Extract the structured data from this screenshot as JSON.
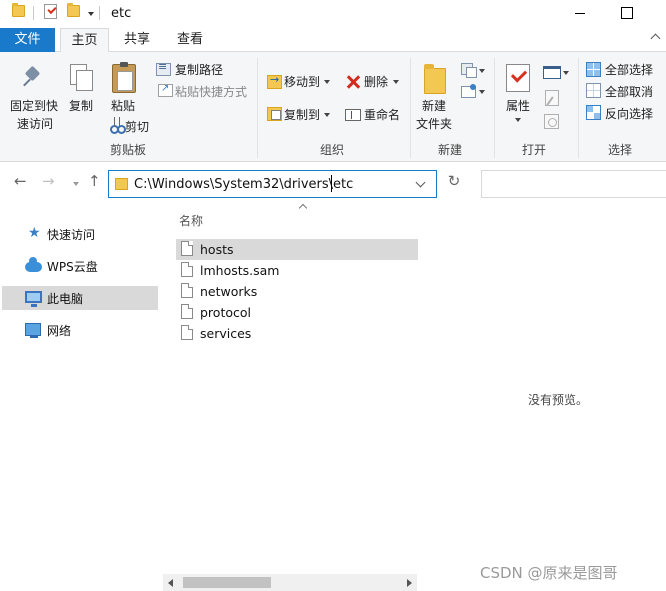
{
  "window": {
    "title": "etc"
  },
  "tabs": [
    {
      "label": "文件"
    },
    {
      "label": "主页"
    },
    {
      "label": "共享"
    },
    {
      "label": "查看"
    }
  ],
  "ribbon": {
    "clipboard": {
      "pin_line1": "固定到快",
      "pin_line2": "速访问",
      "copy": "复制",
      "paste": "粘贴",
      "copy_path": "复制路径",
      "paste_shortcut": "粘贴快捷方式",
      "cut": "剪切",
      "group": "剪贴板"
    },
    "organize": {
      "move_to": "移动到",
      "copy_to": "复制到",
      "delete": "删除",
      "rename": "重命名",
      "group": "组织"
    },
    "new": {
      "new_folder_line1": "新建",
      "new_folder_line2": "文件夹",
      "group": "新建"
    },
    "open": {
      "properties": "属性",
      "group": "打开"
    },
    "select": {
      "select_all": "全部选择",
      "select_none": "全部取消",
      "invert": "反向选择",
      "group": "选择"
    }
  },
  "address": {
    "path": "C:\\Windows\\System32\\drivers\\etc"
  },
  "nav": [
    {
      "label": "快速访问",
      "icon": "star-icon"
    },
    {
      "label": "WPS云盘",
      "icon": "cloud-icon"
    },
    {
      "label": "此电脑",
      "icon": "computer-icon",
      "selected": true
    },
    {
      "label": "网络",
      "icon": "network-icon"
    }
  ],
  "files": {
    "column_name": "名称",
    "items": [
      {
        "name": "hosts",
        "selected": true
      },
      {
        "name": "lmhosts.sam"
      },
      {
        "name": "networks"
      },
      {
        "name": "protocol"
      },
      {
        "name": "services"
      }
    ]
  },
  "preview": {
    "empty_text": "没有预览。"
  },
  "watermark": "CSDN @原来是图哥",
  "colors": {
    "accent": "#1979ca",
    "selection": "#d9d9d9",
    "folder": "#f3c852"
  }
}
